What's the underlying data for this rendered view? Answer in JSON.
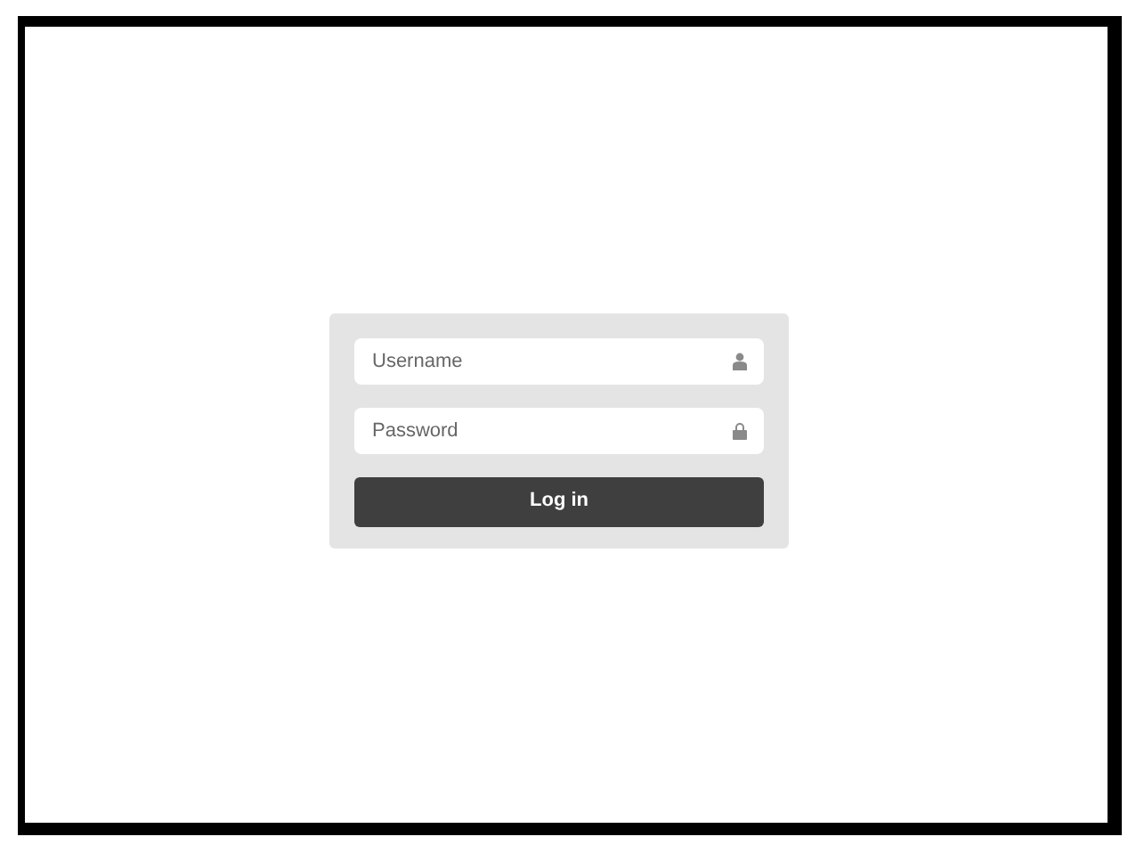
{
  "login_form": {
    "username": {
      "placeholder": "Username"
    },
    "password": {
      "placeholder": "Password"
    },
    "submit_button": "Log in"
  }
}
